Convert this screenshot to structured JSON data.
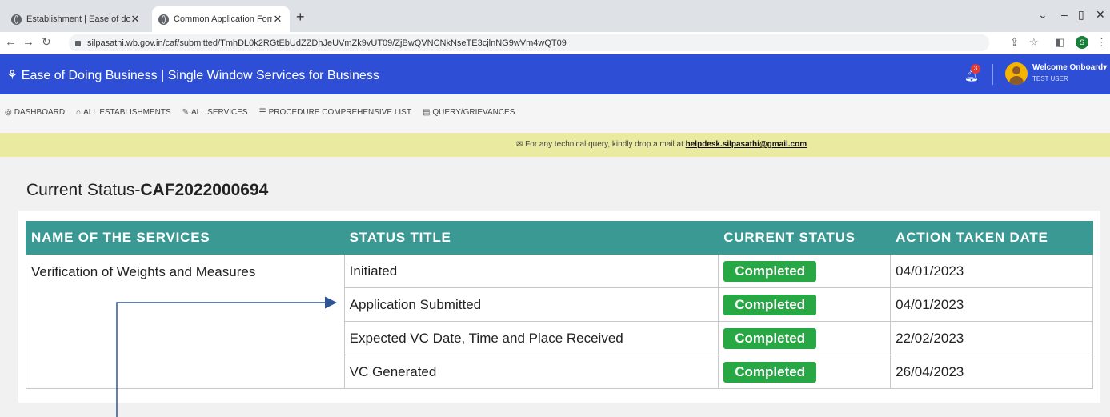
{
  "browser": {
    "tabs": [
      {
        "title": "Establishment | Ease of doing bu",
        "icon": "globe-icon"
      },
      {
        "title": "Common Application Form Prev",
        "icon": "globe-icon"
      }
    ],
    "url": "silpasathi.wb.gov.in/caf/submitted/TmhDL0k2RGtEbUdZZDhJeUVmZk9vUT09/ZjBwQVNCNkNseTE3cjlnNG9wVm4wQT09",
    "profile_initial": "S"
  },
  "header": {
    "title": "Ease of Doing Business | Single Window Services for Business",
    "notification_count": "3",
    "welcome": "Welcome Onboard",
    "user": "TEST USER"
  },
  "menu": [
    {
      "label": "DASHBOARD",
      "icon": "dashboard-icon"
    },
    {
      "label": "ALL ESTABLISHMENTS",
      "icon": "building-icon"
    },
    {
      "label": "ALL SERVICES",
      "icon": "wrench-icon"
    },
    {
      "label": "PROCEDURE COMPREHENSIVE LIST",
      "icon": "list-icon"
    },
    {
      "label": "QUERY/GRIEVANCES",
      "icon": "message-icon"
    }
  ],
  "notice": {
    "text": "For any technical query, kindly drop a mail at",
    "email": "helpdesk.silpasathi@gmail.com"
  },
  "status": {
    "label": "Current Status-",
    "caf_id": "CAF2022000694"
  },
  "table": {
    "headers": [
      "NAME OF THE SERVICES",
      "STATUS TITLE",
      "CURRENT STATUS",
      "ACTION TAKEN DATE"
    ],
    "service_name": "Verification of Weights and Measures",
    "rows": [
      {
        "status_title": "Initiated",
        "current_status": "Completed",
        "date": "04/01/2023"
      },
      {
        "status_title": "Application Submitted",
        "current_status": "Completed",
        "date": "04/01/2023"
      },
      {
        "status_title": "Expected VC Date, Time and Place Received",
        "current_status": "Completed",
        "date": "22/02/2023"
      },
      {
        "status_title": "VC Generated",
        "current_status": "Completed",
        "date": "26/04/2023"
      }
    ]
  },
  "colors": {
    "header_blue": "#2e4fd5",
    "table_header": "#3a9a93",
    "completed_green": "#28a745",
    "notice_yellow": "#eaeba1",
    "annotation_arrow": "#2f5597"
  }
}
